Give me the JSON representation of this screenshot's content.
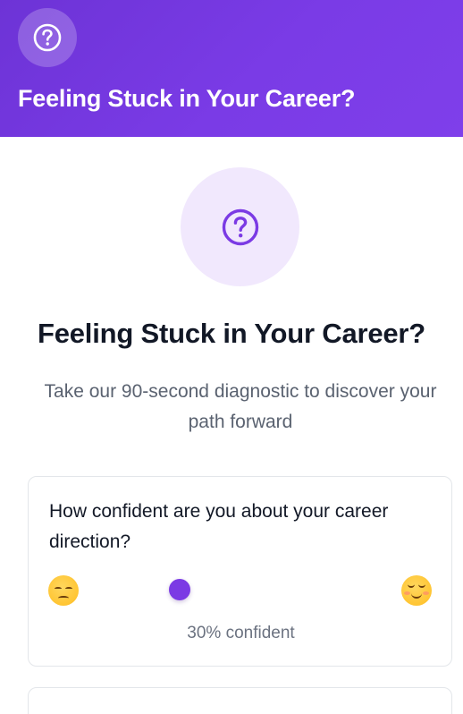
{
  "header": {
    "title": "Feeling Stuck in Your Career?",
    "icon": "question-circle-icon",
    "gradient_colors": [
      "#6d33d6",
      "#7f3fea"
    ]
  },
  "hero": {
    "icon": "question-circle-icon",
    "title": "Feeling Stuck in Your Career?",
    "subtitle": "Take our 90-second diagnostic to discover your path forward"
  },
  "question_card": {
    "question": "How confident are you about your career direction?",
    "left_emoji": "pensive-face-icon",
    "right_emoji": "smiling-face-icon",
    "slider_value_percent": 30,
    "confidence_label": "30% confident"
  },
  "colors": {
    "accent": "#7b3ae4",
    "hero_circle_bg": "#f1e8fd",
    "text_primary": "#121826",
    "text_secondary": "#5a6270"
  }
}
